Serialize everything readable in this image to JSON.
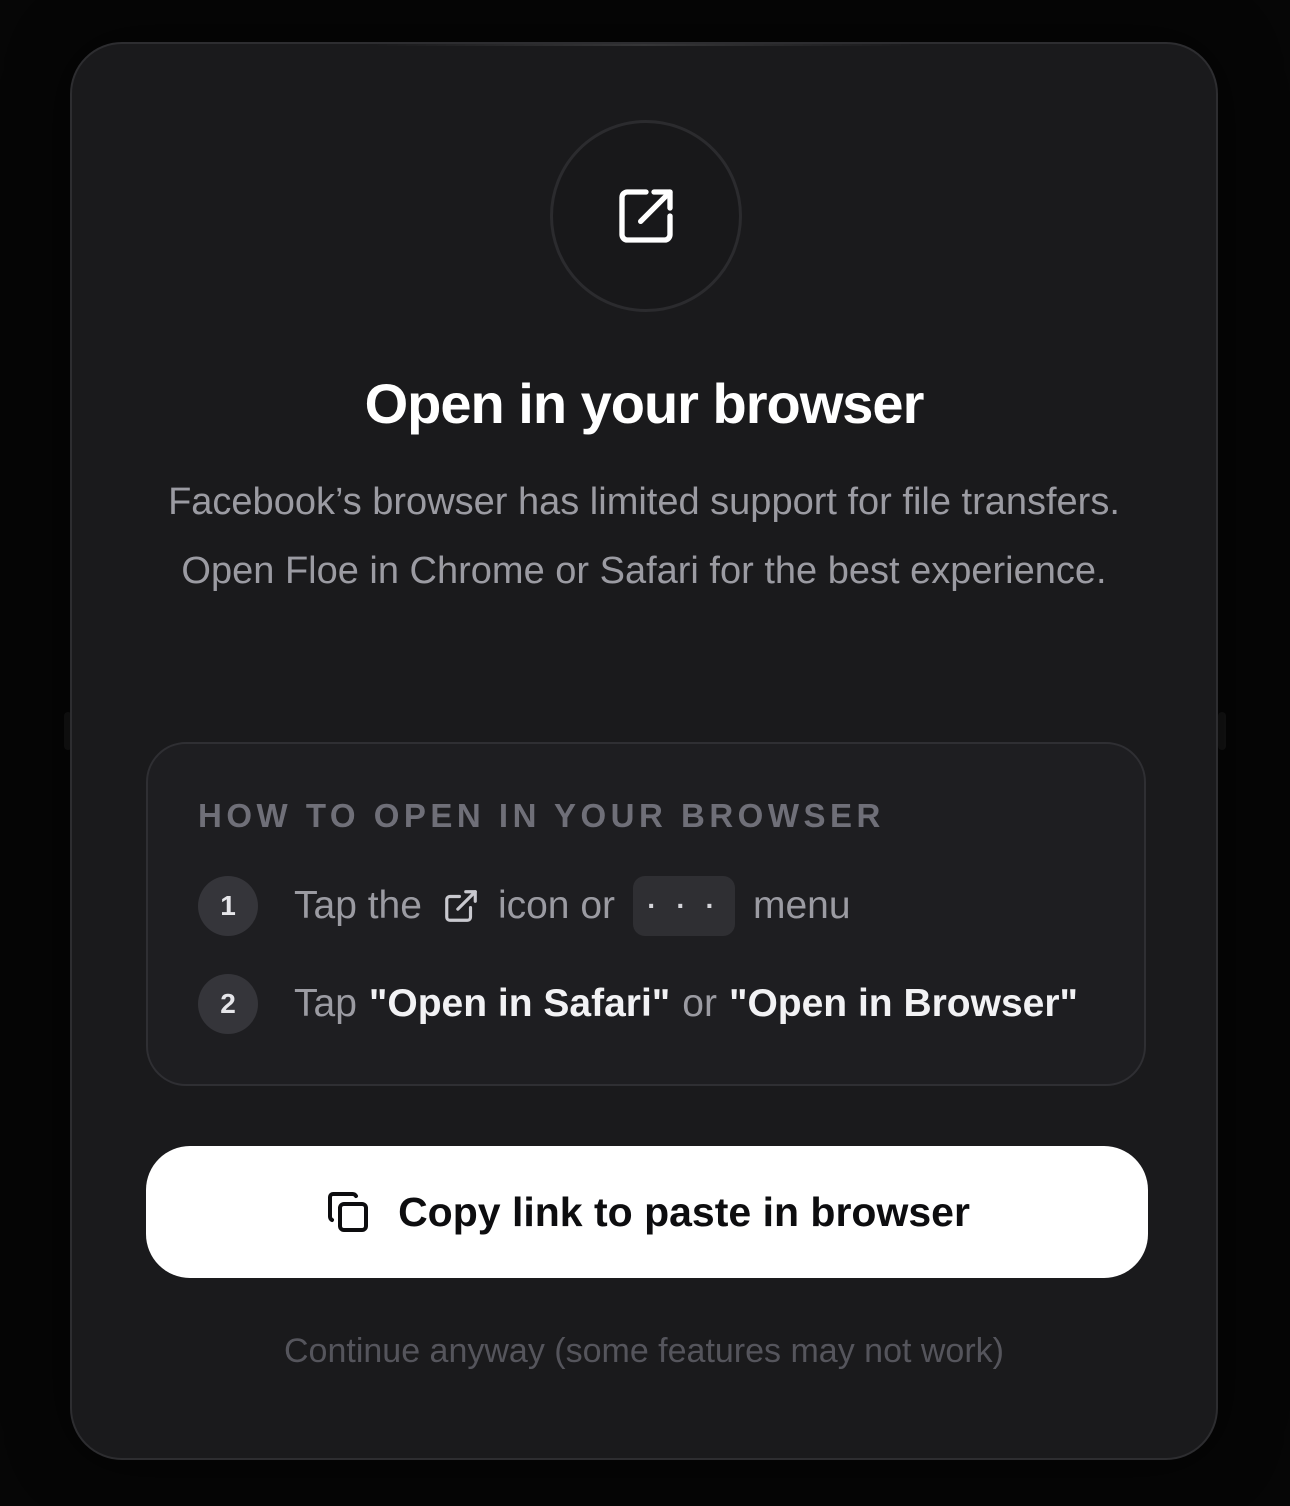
{
  "dialog": {
    "title": "Open in your browser",
    "description": "Facebook’s browser has limited support for file transfers. Open Floe in Chrome or Safari for the best experience.",
    "header_icon": "external-link-icon"
  },
  "howto": {
    "heading": "HOW TO OPEN IN YOUR BROWSER",
    "steps": [
      {
        "number": "1",
        "text_before": "Tap the",
        "icon": "external-link-icon",
        "text_middle": "icon or",
        "menu_label": "· · ·",
        "text_after": "menu"
      },
      {
        "number": "2",
        "text_before": "Tap",
        "option_a": "\"Open in Safari\"",
        "connector": "or",
        "option_b": "\"Open in Browser\""
      }
    ]
  },
  "actions": {
    "copy_label": "Copy link to paste in browser",
    "copy_icon": "copy-icon",
    "continue_label": "Continue anyway (some features may not work)"
  },
  "colors": {
    "background": "#060606",
    "card": "#1a1a1c",
    "primary_text": "#ffffff",
    "muted_text": "#9b9ba2",
    "button_bg": "#ffffff"
  }
}
